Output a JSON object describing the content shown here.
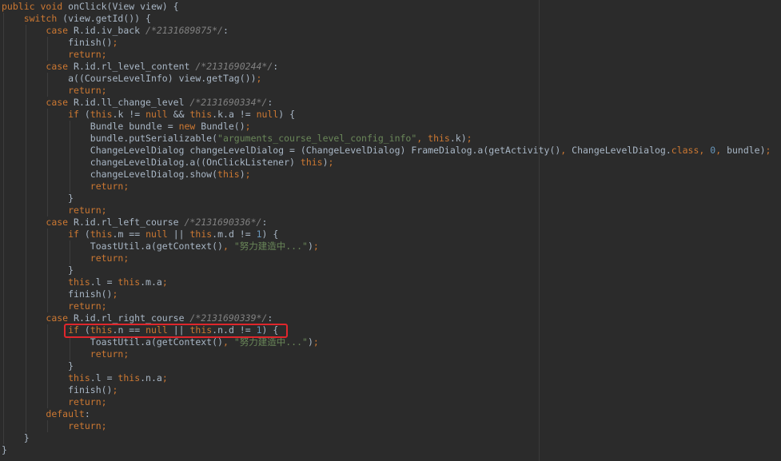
{
  "editor": {
    "background": "#2b2b2b",
    "highlight_color": "#e0262c",
    "highlighted_line_index": 27,
    "lines": [
      {
        "indent": 0,
        "tokens": [
          [
            "kw",
            "public "
          ],
          [
            "kw",
            "void "
          ],
          [
            "p",
            "onClick(View view) {"
          ]
        ]
      },
      {
        "indent": 1,
        "tokens": [
          [
            "kw",
            "switch "
          ],
          [
            "p",
            "(view.getId()) {"
          ]
        ]
      },
      {
        "indent": 2,
        "tokens": [
          [
            "kw",
            "case "
          ],
          [
            "p",
            "R.id.iv_back "
          ],
          [
            "cm",
            "/*2131689875*/"
          ],
          [
            "p",
            ":"
          ]
        ]
      },
      {
        "indent": 3,
        "tokens": [
          [
            "p",
            "finish()"
          ],
          [
            "kw",
            ";"
          ]
        ]
      },
      {
        "indent": 3,
        "tokens": [
          [
            "kw",
            "return;"
          ]
        ]
      },
      {
        "indent": 2,
        "tokens": [
          [
            "kw",
            "case "
          ],
          [
            "p",
            "R.id.rl_level_content "
          ],
          [
            "cm",
            "/*2131690244*/"
          ],
          [
            "p",
            ":"
          ]
        ]
      },
      {
        "indent": 3,
        "tokens": [
          [
            "p",
            "a((CourseLevelInfo) view.getTag())"
          ],
          [
            "kw",
            ";"
          ]
        ]
      },
      {
        "indent": 3,
        "tokens": [
          [
            "kw",
            "return;"
          ]
        ]
      },
      {
        "indent": 2,
        "tokens": [
          [
            "kw",
            "case "
          ],
          [
            "p",
            "R.id.ll_change_level "
          ],
          [
            "cm",
            "/*2131690334*/"
          ],
          [
            "p",
            ":"
          ]
        ]
      },
      {
        "indent": 3,
        "tokens": [
          [
            "kw",
            "if "
          ],
          [
            "p",
            "("
          ],
          [
            "kw",
            "this"
          ],
          [
            "p",
            ".k != "
          ],
          [
            "kw",
            "null "
          ],
          [
            "p",
            "&& "
          ],
          [
            "kw",
            "this"
          ],
          [
            "p",
            ".k.a != "
          ],
          [
            "kw",
            "null"
          ],
          [
            "p",
            ") {"
          ]
        ]
      },
      {
        "indent": 4,
        "tokens": [
          [
            "p",
            "Bundle bundle = "
          ],
          [
            "kw",
            "new "
          ],
          [
            "p",
            "Bundle()"
          ],
          [
            "kw",
            ";"
          ]
        ]
      },
      {
        "indent": 4,
        "tokens": [
          [
            "p",
            "bundle.putSerializable("
          ],
          [
            "str",
            "\"arguments_course_level_config_info\""
          ],
          [
            "kw",
            ", "
          ],
          [
            "kw",
            "this"
          ],
          [
            "p",
            ".k)"
          ],
          [
            "kw",
            ";"
          ]
        ]
      },
      {
        "indent": 4,
        "tokens": [
          [
            "p",
            "ChangeLevelDialog changeLevelDialog = (ChangeLevelDialog) FrameDialog.a(getActivity()"
          ],
          [
            "kw",
            ", "
          ],
          [
            "p",
            "ChangeLevelDialog."
          ],
          [
            "kw",
            "class"
          ],
          [
            "kw",
            ", "
          ],
          [
            "num",
            "0"
          ],
          [
            "kw",
            ", "
          ],
          [
            "p",
            "bundle)"
          ],
          [
            "kw",
            ";"
          ]
        ]
      },
      {
        "indent": 4,
        "tokens": [
          [
            "p",
            "changeLevelDialog.a((OnClickListener) "
          ],
          [
            "kw",
            "this"
          ],
          [
            "p",
            ")"
          ],
          [
            "kw",
            ";"
          ]
        ]
      },
      {
        "indent": 4,
        "tokens": [
          [
            "p",
            "changeLevelDialog.show("
          ],
          [
            "kw",
            "this"
          ],
          [
            "p",
            ")"
          ],
          [
            "kw",
            ";"
          ]
        ]
      },
      {
        "indent": 4,
        "tokens": [
          [
            "kw",
            "return;"
          ]
        ]
      },
      {
        "indent": 3,
        "tokens": [
          [
            "p",
            "}"
          ]
        ]
      },
      {
        "indent": 3,
        "tokens": [
          [
            "kw",
            "return;"
          ]
        ]
      },
      {
        "indent": 2,
        "tokens": [
          [
            "kw",
            "case "
          ],
          [
            "p",
            "R.id.rl_left_course "
          ],
          [
            "cm",
            "/*2131690336*/"
          ],
          [
            "p",
            ":"
          ]
        ]
      },
      {
        "indent": 3,
        "tokens": [
          [
            "kw",
            "if "
          ],
          [
            "p",
            "("
          ],
          [
            "kw",
            "this"
          ],
          [
            "p",
            ".m == "
          ],
          [
            "kw",
            "null "
          ],
          [
            "p",
            "|| "
          ],
          [
            "kw",
            "this"
          ],
          [
            "p",
            ".m.d != "
          ],
          [
            "num",
            "1"
          ],
          [
            "p",
            ") {"
          ]
        ]
      },
      {
        "indent": 4,
        "tokens": [
          [
            "p",
            "ToastUtil.a(getContext()"
          ],
          [
            "kw",
            ", "
          ],
          [
            "str",
            "\"努力建造中...\""
          ],
          [
            "p",
            ")"
          ],
          [
            "kw",
            ";"
          ]
        ]
      },
      {
        "indent": 4,
        "tokens": [
          [
            "kw",
            "return;"
          ]
        ]
      },
      {
        "indent": 3,
        "tokens": [
          [
            "p",
            "}"
          ]
        ]
      },
      {
        "indent": 3,
        "tokens": [
          [
            "kw",
            "this"
          ],
          [
            "p",
            ".l = "
          ],
          [
            "kw",
            "this"
          ],
          [
            "p",
            ".m.a"
          ],
          [
            "kw",
            ";"
          ]
        ]
      },
      {
        "indent": 3,
        "tokens": [
          [
            "p",
            "finish()"
          ],
          [
            "kw",
            ";"
          ]
        ]
      },
      {
        "indent": 3,
        "tokens": [
          [
            "kw",
            "return;"
          ]
        ]
      },
      {
        "indent": 2,
        "tokens": [
          [
            "kw",
            "case "
          ],
          [
            "p",
            "R.id.rl_right_course "
          ],
          [
            "cm",
            "/*2131690339*/"
          ],
          [
            "p",
            ":"
          ]
        ]
      },
      {
        "indent": 3,
        "tokens": [
          [
            "kw",
            "if "
          ],
          [
            "p",
            "("
          ],
          [
            "kw",
            "this"
          ],
          [
            "p",
            ".n == "
          ],
          [
            "kw",
            "null "
          ],
          [
            "p",
            "|| "
          ],
          [
            "kw",
            "this"
          ],
          [
            "p",
            ".n.d != "
          ],
          [
            "num",
            "1"
          ],
          [
            "p",
            ") {"
          ]
        ]
      },
      {
        "indent": 4,
        "tokens": [
          [
            "p",
            "ToastUtil.a(getContext()"
          ],
          [
            "kw",
            ", "
          ],
          [
            "str",
            "\"努力建造中...\""
          ],
          [
            "p",
            ")"
          ],
          [
            "kw",
            ";"
          ]
        ]
      },
      {
        "indent": 4,
        "tokens": [
          [
            "kw",
            "return;"
          ]
        ]
      },
      {
        "indent": 3,
        "tokens": [
          [
            "p",
            "}"
          ]
        ]
      },
      {
        "indent": 3,
        "tokens": [
          [
            "kw",
            "this"
          ],
          [
            "p",
            ".l = "
          ],
          [
            "kw",
            "this"
          ],
          [
            "p",
            ".n.a"
          ],
          [
            "kw",
            ";"
          ]
        ]
      },
      {
        "indent": 3,
        "tokens": [
          [
            "p",
            "finish()"
          ],
          [
            "kw",
            ";"
          ]
        ]
      },
      {
        "indent": 3,
        "tokens": [
          [
            "kw",
            "return;"
          ]
        ]
      },
      {
        "indent": 2,
        "tokens": [
          [
            "kw",
            "default"
          ],
          [
            "p",
            ":"
          ]
        ]
      },
      {
        "indent": 3,
        "tokens": [
          [
            "kw",
            "return;"
          ]
        ]
      },
      {
        "indent": 1,
        "tokens": [
          [
            "p",
            "}"
          ]
        ]
      },
      {
        "indent": 0,
        "tokens": [
          [
            "p",
            "}"
          ]
        ]
      }
    ]
  }
}
